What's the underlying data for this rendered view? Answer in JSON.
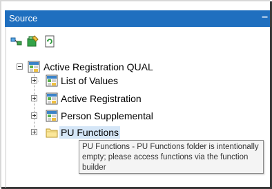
{
  "panel": {
    "title": "Source",
    "minimize_label": "–"
  },
  "toolbar": {
    "buttons": [
      {
        "name": "link-items-icon"
      },
      {
        "name": "new-folder-edit-icon"
      },
      {
        "name": "refresh-document-icon"
      }
    ]
  },
  "tree": {
    "root": {
      "label": "Active Registration QUAL",
      "expanded": true
    },
    "children": [
      {
        "label": "List of Values",
        "icon": "table-icon"
      },
      {
        "label": "Active Registration",
        "icon": "table-icon"
      },
      {
        "label": "Person Supplemental",
        "icon": "table-icon"
      },
      {
        "label": "PU Functions",
        "icon": "folder-icon",
        "selected": true
      }
    ]
  },
  "tooltip": {
    "text": "PU Functions - PU Functions folder is intentionally empty; please access functions via the function builder"
  },
  "colors": {
    "titlebar": "#1f6fbf",
    "selection": "#d5e6f7"
  }
}
